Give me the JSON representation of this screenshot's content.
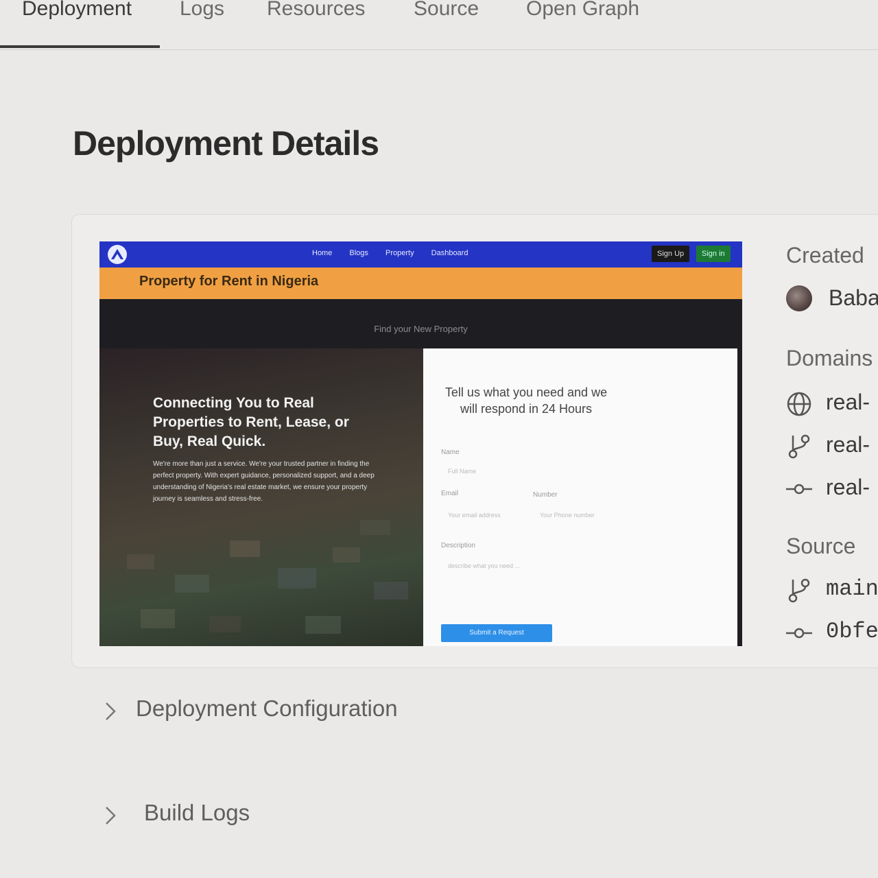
{
  "tabs": [
    {
      "label": "Deployment",
      "active": true
    },
    {
      "label": "Logs"
    },
    {
      "label": "Resources"
    },
    {
      "label": "Source"
    },
    {
      "label": "Open Graph"
    }
  ],
  "page": {
    "title": "Deployment Details"
  },
  "preview": {
    "nav_links": [
      "Home",
      "Blogs",
      "Property",
      "Dashboard"
    ],
    "signup_label": "Sign Up",
    "signin_label": "Sign in",
    "banner": "Property for Rent in Nigeria",
    "find_text": "Find your New Property",
    "hero_title": "Connecting You to Real Properties to Rent, Lease, or Buy, Real Quick.",
    "hero_sub": "We're more than just a service. We're your trusted partner in finding the perfect property. With expert guidance, personalized support, and a deep understanding of Nigeria's real estate market, we ensure your property journey is seamless and stress-free.",
    "form": {
      "title": "Tell us what you need and we will respond in 24 Hours",
      "name_label": "Name",
      "name_placeholder": "Full Name",
      "email_label": "Email",
      "email_placeholder": "Your email address",
      "number_label": "Number",
      "number_placeholder": "Your Phone number",
      "description_label": "Description",
      "description_placeholder": "describe what you need ...",
      "submit_label": "Submit a Request"
    }
  },
  "sidebar": {
    "created_label": "Created",
    "created_by": "Baba",
    "domains_label": "Domains",
    "domains": [
      "real-",
      "real-",
      "real-"
    ],
    "source_label": "Source",
    "branch": "main",
    "commit": "0bfe"
  },
  "sections": [
    {
      "label": "Deployment Configuration"
    },
    {
      "label": "Build Logs"
    }
  ],
  "colors": {
    "nav": "#2434c4",
    "banner": "#f0a043",
    "submit": "#2d8fe8"
  }
}
